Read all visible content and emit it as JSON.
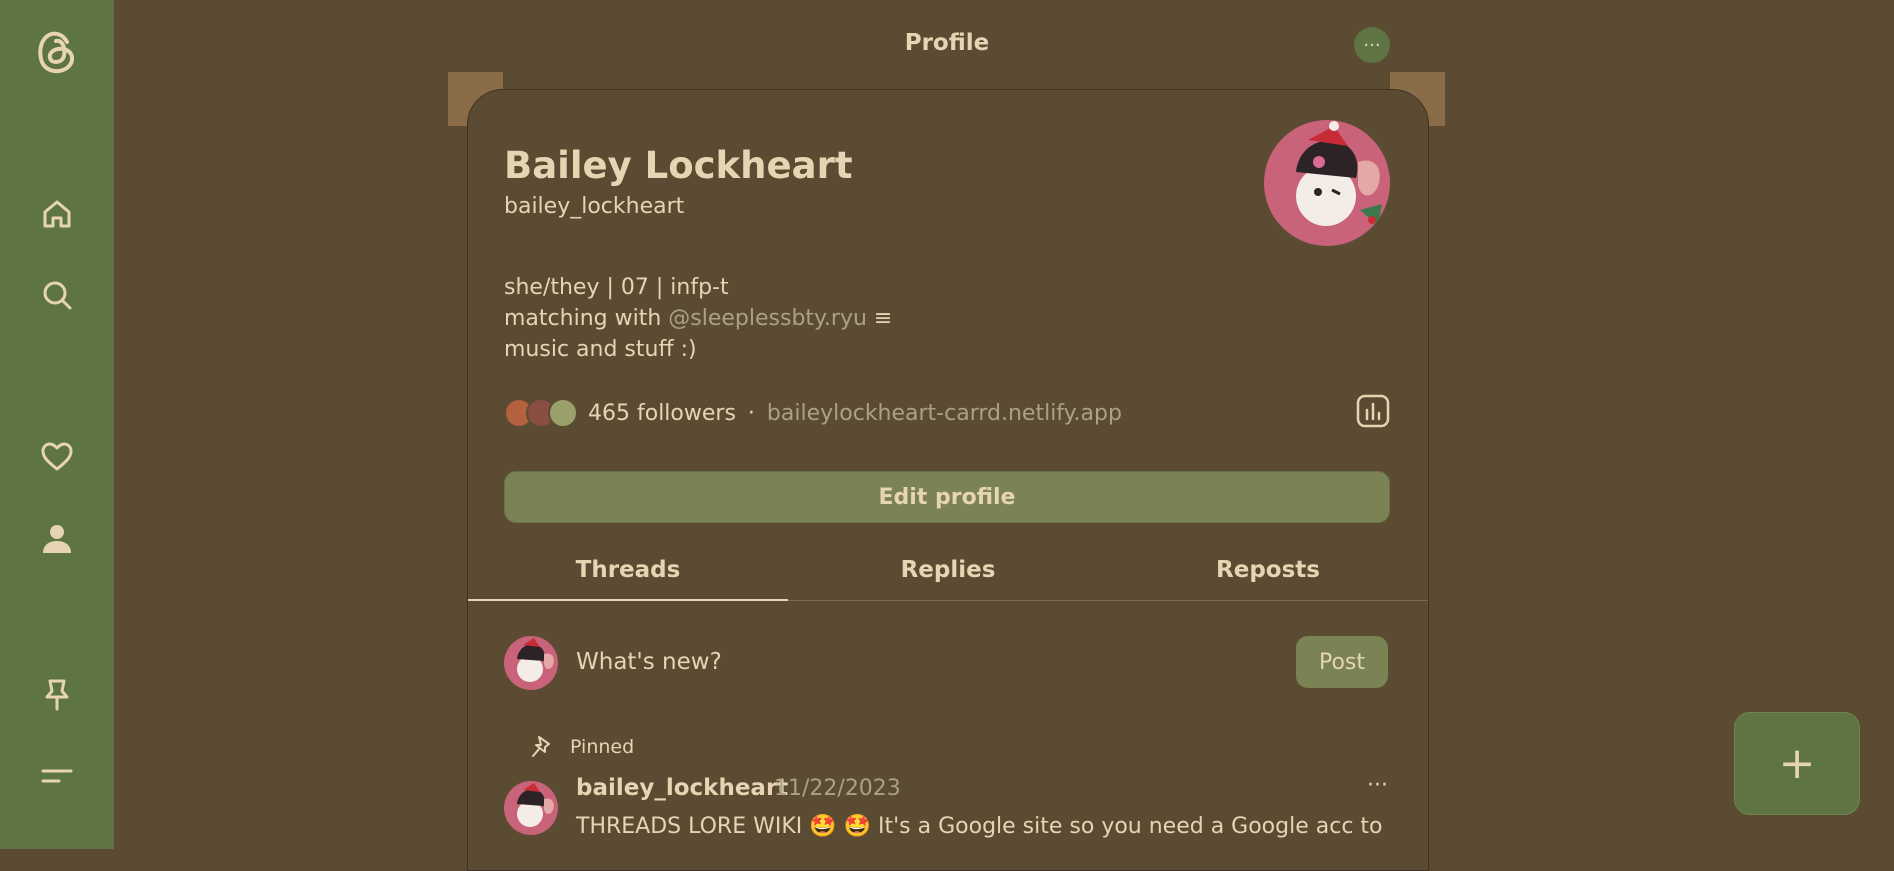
{
  "header": {
    "title": "Profile",
    "menu_label": "···"
  },
  "sidebar": {
    "items": [
      {
        "name": "home",
        "icon": "home-icon"
      },
      {
        "name": "search",
        "icon": "search-icon"
      },
      {
        "name": "activity",
        "icon": "heart-icon"
      },
      {
        "name": "profile",
        "icon": "user-icon"
      },
      {
        "name": "pinned",
        "icon": "pin-icon"
      },
      {
        "name": "more",
        "icon": "menu-icon"
      }
    ]
  },
  "profile": {
    "name": "Bailey Lockheart",
    "handle": "bailey_lockheart",
    "bio": {
      "line1": "she/they | 07 | infp-t",
      "line2_prefix": "matching with ",
      "line2_mention": "@sleeplessbty.ryu",
      "line2_suffix": " ≡",
      "line3": "music and stuff :)"
    },
    "followers": "465 followers",
    "separator": "·",
    "link": "baileylockheart-carrd.netlify.app",
    "edit_label": "Edit profile"
  },
  "tabs": [
    {
      "label": "Threads",
      "active": true
    },
    {
      "label": "Replies",
      "active": false
    },
    {
      "label": "Reposts",
      "active": false
    }
  ],
  "composer": {
    "placeholder": "What's new?",
    "post_label": "Post"
  },
  "feed": {
    "pinned_label": "Pinned",
    "post": {
      "author": "bailey_lockheart",
      "date": "11/22/2023",
      "text": "THREADS LORE WIKI 🤩 🤩 It's a Google site so you need a Google acc to",
      "more": "···"
    }
  },
  "fab": {
    "label": "+"
  },
  "colors": {
    "background": "#5c4b33",
    "sidebar": "#5f7443",
    "button": "#7b8355",
    "text": "#e6d4b2",
    "muted": "#a7a286"
  }
}
